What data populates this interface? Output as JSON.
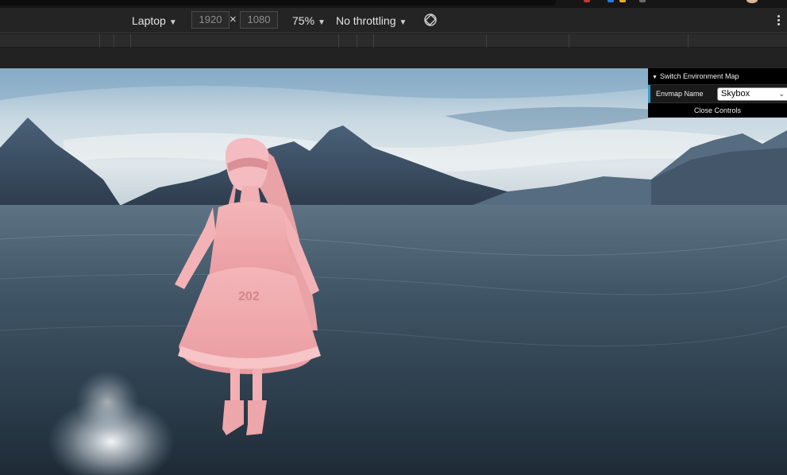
{
  "device_toolbar": {
    "device": "Laptop",
    "width": "1920",
    "height": "1080",
    "times": "×",
    "zoom": "75%",
    "throttling": "No throttling"
  },
  "gui": {
    "folder_title": "Switch Environment Map",
    "envmap_label": "Envmap Name",
    "envmap_value": "Skybox",
    "close_label": "Close Controls"
  },
  "model": {
    "chest_text": "202"
  },
  "colors": {
    "toolbar_bg": "#242424",
    "gui_accent": "#2fa1d6",
    "model_tint": "#f0a9ad"
  }
}
